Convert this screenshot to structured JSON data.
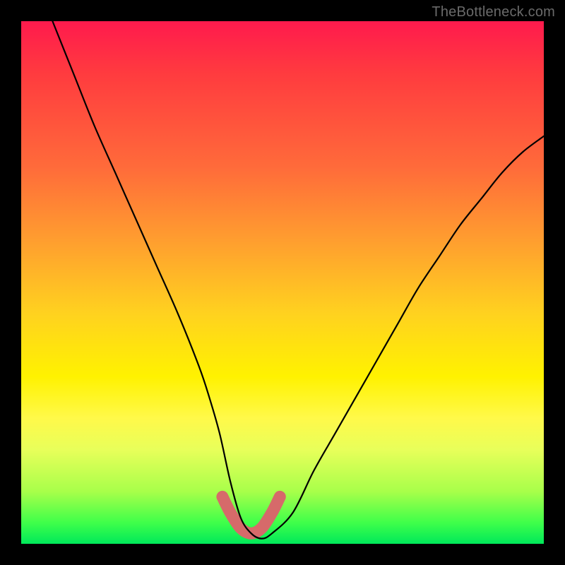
{
  "watermark": "TheBottleneck.com",
  "chart_data": {
    "type": "line",
    "title": "",
    "xlabel": "",
    "ylabel": "",
    "xlim": [
      0,
      100
    ],
    "ylim": [
      0,
      100
    ],
    "series": [
      {
        "name": "bottleneck-curve",
        "x": [
          6,
          10,
          14,
          18,
          22,
          26,
          30,
          34,
          36,
          38,
          40,
          42,
          44,
          46,
          48,
          52,
          56,
          60,
          64,
          68,
          72,
          76,
          80,
          84,
          88,
          92,
          96,
          100
        ],
        "values": [
          100,
          90,
          80,
          71,
          62,
          53,
          44,
          34,
          28,
          21,
          12,
          5,
          2,
          1,
          2,
          6,
          14,
          21,
          28,
          35,
          42,
          49,
          55,
          61,
          66,
          71,
          75,
          78
        ]
      },
      {
        "name": "highlight-band",
        "x": [
          38.5,
          40,
          42,
          44,
          46,
          48,
          49.5
        ],
        "values": [
          9,
          6,
          3,
          2,
          3,
          6,
          9
        ]
      }
    ],
    "colors": {
      "curve": "#000000",
      "highlight": "#d66a6a"
    }
  }
}
